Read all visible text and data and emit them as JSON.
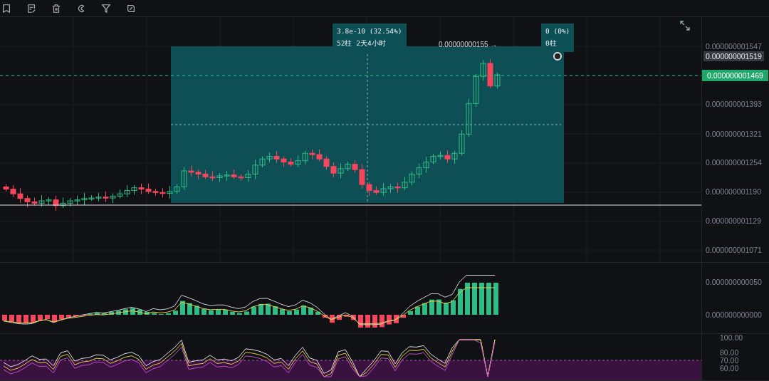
{
  "price_chart": {
    "high_label": "0.00000000155 →",
    "measure": {
      "start_tooltip": {
        "change": "3.8e-10 (32.54%)",
        "bars": "52柱 2天4小时"
      },
      "end_tooltip": {
        "change": "0 (0%)",
        "bars": "0柱"
      }
    },
    "axis": [
      {
        "label": "0.000000001547",
        "kind": "tick"
      },
      {
        "label": "0.000000001519",
        "kind": "crosshair"
      },
      {
        "label": "0.000000001469",
        "kind": "last"
      },
      {
        "label": "0.000000001393",
        "kind": "tick"
      },
      {
        "label": "0.000000001321",
        "kind": "tick"
      },
      {
        "label": "0.000000001254",
        "kind": "tick"
      },
      {
        "label": "0.000000001190",
        "kind": "tick"
      },
      {
        "label": "0.000000001129",
        "kind": "tick"
      },
      {
        "label": "0.000000001071",
        "kind": "tick"
      }
    ]
  },
  "macd_panel": {
    "axis": [
      {
        "label": "0.000000000050"
      },
      {
        "label": "0.000000000000"
      }
    ]
  },
  "oscillator_panel": {
    "axis": [
      {
        "label": "100.00"
      },
      {
        "label": "80.00"
      },
      {
        "label": "70.00"
      },
      {
        "label": "60.00"
      }
    ]
  }
}
